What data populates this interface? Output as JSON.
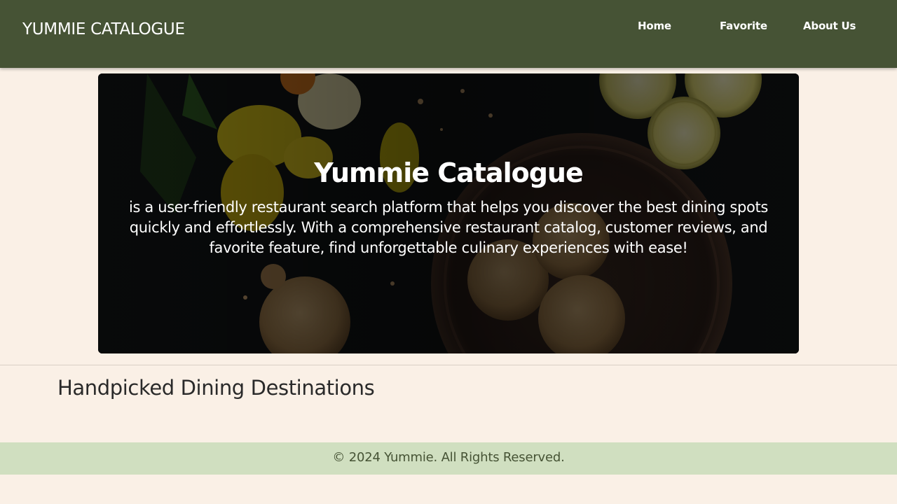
{
  "header": {
    "brand": "YUMMIE CATALOGUE",
    "nav": {
      "home": "Home",
      "favorite": "Favorite",
      "about": "About Us"
    }
  },
  "hero": {
    "title": "Yummie Catalogue",
    "description": "is a user-friendly restaurant search platform that helps you discover the best dining spots quickly and effortlessly. With a comprehensive restaurant catalog, customer reviews, and favorite feature, find unforgettable culinary experiences with ease!"
  },
  "main": {
    "section_title": "Handpicked Dining Destinations"
  },
  "footer": {
    "text": "© 2024 Yummie. All Rights Reserved."
  },
  "colors": {
    "navbar": "#465335",
    "page_background": "#faf0e6",
    "footer_background": "#d0dfc0"
  }
}
